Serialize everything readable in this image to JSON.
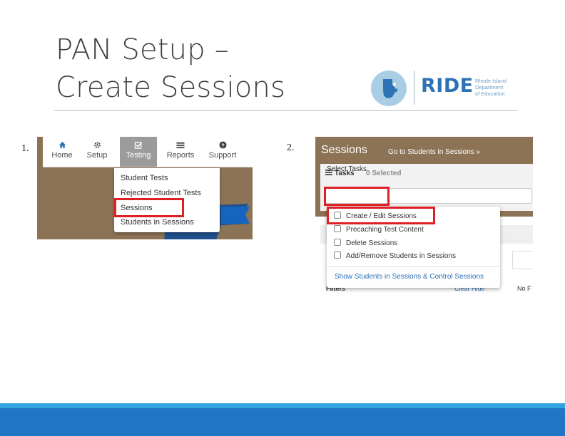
{
  "slide": {
    "title_line1": "PAN Setup –",
    "title_line2": "Create Sessions"
  },
  "logo": {
    "word": "RIDE",
    "subtitle": [
      "Rhode Island",
      "Department",
      "of Education"
    ]
  },
  "steps": [
    "1.",
    "2."
  ],
  "screenshot1": {
    "nav": [
      {
        "label": "Home",
        "icon": "home-icon"
      },
      {
        "label": "Setup",
        "icon": "gear-icon"
      },
      {
        "label": "Testing",
        "icon": "checkbox-icon",
        "active": true
      },
      {
        "label": "Reports",
        "icon": "list-icon"
      },
      {
        "label": "Support",
        "icon": "question-icon"
      }
    ],
    "menu": [
      "Student Tests",
      "Rejected Student Tests",
      "Sessions",
      "Students in Sessions"
    ],
    "highlighted": "Sessions"
  },
  "screenshot2": {
    "header_title": "Sessions",
    "header_link": "Go to Students in Sessions »",
    "tasks_label": "Tasks",
    "tasks_selected": "0 Selected",
    "select_label": "Select Tasks",
    "tasks_menu": [
      "Create / Edit Sessions",
      "Precaching Test Content",
      "Delete Sessions",
      "Add/Remove Students in Sessions"
    ],
    "tasks_link": "Show Students in Sessions & Control Sessions",
    "filters_label": "Filters",
    "clear_label": "Clear  Hide",
    "no_label": "No F"
  },
  "colors": {
    "brown": "#8c7355",
    "highlight_red": "#e01e25",
    "ride_blue": "#2c72b5",
    "band_blue": "#2274c5",
    "band_light": "#33a6df"
  }
}
